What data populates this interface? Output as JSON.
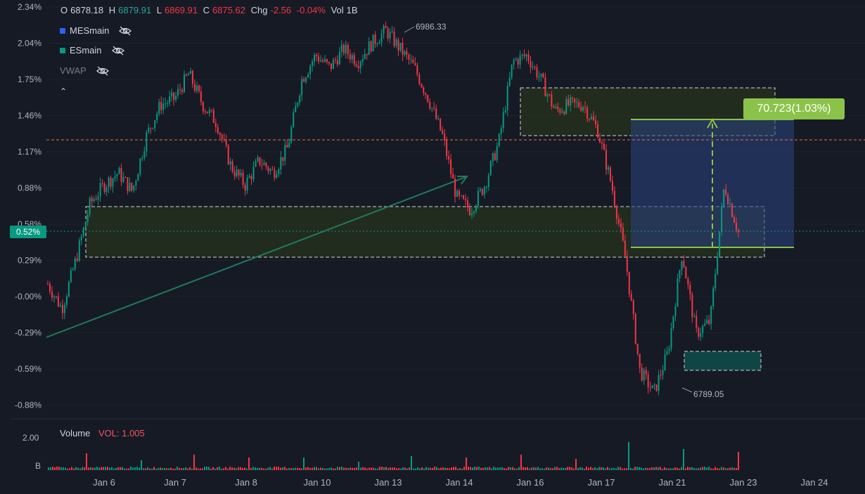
{
  "ohlc": {
    "o_label": "O",
    "o_value": "6878.18",
    "h_label": "H",
    "h_value": "6879.91",
    "l_label": "L",
    "l_value": "6869.91",
    "c_label": "C",
    "c_value": "6875.62",
    "chg_label": "Chg",
    "chg_value": "-2.56",
    "chg_pct": "-0.04%",
    "vol_label": "Vol",
    "vol_value": "1B"
  },
  "legend": {
    "mes": {
      "label": "MESmain",
      "color": "#2962ff"
    },
    "es": {
      "label": "ESmain",
      "color": "#089981"
    },
    "vwap": {
      "label": "VWAP"
    },
    "collapse_icon": "chevron-up-icon"
  },
  "volume_pane": {
    "label": "Volume",
    "vol_text": "VOL: 1.005",
    "axis_top": "2.00",
    "axis_unit": "B"
  },
  "measure_label": "70.723(1.03%)",
  "current_pct": "0.52%",
  "high_marker": "6986.33",
  "low_marker": "6789.05",
  "chart_data": {
    "type": "candlestick",
    "y_axis_labels": [
      "2.34%",
      "2.04%",
      "1.75%",
      "1.46%",
      "1.17%",
      "0.88%",
      "0.58%",
      "0.29%",
      "-0.00%",
      "-0.29%",
      "-0.59%",
      "-0.88%"
    ],
    "x_axis_labels": [
      "Jan 6",
      "Jan 7",
      "Jan 8",
      "Jan 10",
      "Jan 13",
      "Jan 14",
      "Jan 16",
      "Jan 17",
      "Jan 21",
      "Jan 23",
      "Jan 24"
    ],
    "close_pct_path": [
      0.1,
      -0.1,
      0.3,
      0.75,
      0.9,
      1.0,
      0.85,
      1.3,
      1.55,
      1.6,
      1.8,
      1.55,
      1.4,
      1.05,
      0.9,
      1.1,
      1.0,
      1.2,
      1.75,
      1.95,
      1.85,
      2.0,
      1.9,
      2.05,
      2.15,
      2.0,
      1.85,
      1.6,
      1.3,
      0.8,
      0.7,
      0.9,
      1.25,
      1.9,
      1.95,
      1.75,
      1.5,
      1.55,
      1.55,
      1.35,
      0.9,
      0.3,
      -0.6,
      -0.78,
      -0.45,
      0.35,
      -0.3,
      -0.2,
      0.9,
      0.52
    ],
    "up_color": "#089981",
    "down_color": "#f23645",
    "reference_line_pct": 1.25,
    "current_line_pct": 0.52
  }
}
